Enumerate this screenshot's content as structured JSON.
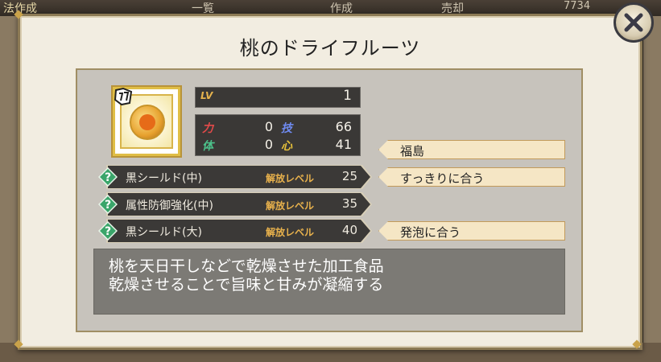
{
  "background": {
    "tabs": [
      "一覧",
      "作成",
      "売却"
    ],
    "left_banner": "法作成",
    "coin_text": "7734"
  },
  "dialog": {
    "title": "桃のドライフルーツ",
    "close_icon": "close-x-icon"
  },
  "item": {
    "icon": "peach-orb-icon",
    "level_label": "LV",
    "level": "1"
  },
  "stats": {
    "power_label": "力",
    "power": "0",
    "tech_label": "技",
    "tech": "66",
    "body_label": "体",
    "body": "0",
    "heart_label": "心",
    "heart": "41"
  },
  "tags": [
    "福島",
    "すっきりに合う",
    "発泡に合う"
  ],
  "skills": [
    {
      "name": "黒シールド(中)",
      "unlock_label": "解放レベル",
      "level": "25"
    },
    {
      "name": "属性防御強化(中)",
      "unlock_label": "解放レベル",
      "level": "35"
    },
    {
      "name": "黒シールド(大)",
      "unlock_label": "解放レベル",
      "level": "40"
    }
  ],
  "description": {
    "line1": "桃を天日干しなどで乾燥させた加工食品",
    "line2": "乾燥させることで旨味と甘みが凝縮する"
  },
  "colors": {
    "panel": "#c7c3bc",
    "dark_box": "#3a3836",
    "tag": "#f5e6c5",
    "accent_gold": "#e0be46",
    "skill_diamond": "#3aa56a"
  }
}
